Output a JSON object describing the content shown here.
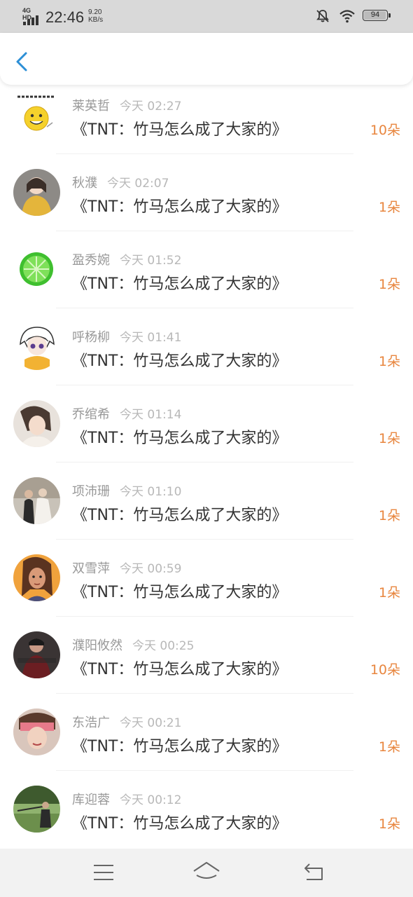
{
  "status_bar": {
    "network": "4G HD",
    "time": "22:46",
    "speed_value": "9.20",
    "speed_unit": "KB/s",
    "battery": "94",
    "icons": [
      "signal-icon",
      "mute-bell-icon",
      "wifi-icon",
      "battery-icon"
    ]
  },
  "header": {
    "back_icon": "back-arrow-icon",
    "accent_color": "#2c8fd6"
  },
  "gifts": [
    {
      "name": "莱英哲",
      "time": "今天 02:27",
      "title": "《TNT：竹马怎么成了大家的》",
      "count": "10朵"
    },
    {
      "name": "秋濮",
      "time": "今天 02:07",
      "title": "《TNT：竹马怎么成了大家的》",
      "count": "1朵"
    },
    {
      "name": "盈秀婉",
      "time": "今天 01:52",
      "title": "《TNT：竹马怎么成了大家的》",
      "count": "1朵"
    },
    {
      "name": "呼杨柳",
      "time": "今天 01:41",
      "title": "《TNT：竹马怎么成了大家的》",
      "count": "1朵"
    },
    {
      "name": "乔绾希",
      "time": "今天 01:14",
      "title": "《TNT：竹马怎么成了大家的》",
      "count": "1朵"
    },
    {
      "name": "项沛珊",
      "time": "今天 01:10",
      "title": "《TNT：竹马怎么成了大家的》",
      "count": "1朵"
    },
    {
      "name": "双雪萍",
      "time": "今天 00:59",
      "title": "《TNT：竹马怎么成了大家的》",
      "count": "1朵"
    },
    {
      "name": "濮阳攸然",
      "time": "今天 00:25",
      "title": "《TNT：竹马怎么成了大家的》",
      "count": "10朵"
    },
    {
      "name": "东浩广",
      "time": "今天 00:21",
      "title": "《TNT：竹马怎么成了大家的》",
      "count": "1朵"
    },
    {
      "name": "库迎蓉",
      "time": "今天 00:12",
      "title": "《TNT：竹马怎么成了大家的》",
      "count": "1朵"
    }
  ],
  "nav": {
    "icons": [
      "menu-icon",
      "home-icon",
      "return-icon"
    ]
  },
  "colors": {
    "count_color": "#e8863f",
    "name_color": "#999999",
    "title_color": "#333333"
  }
}
